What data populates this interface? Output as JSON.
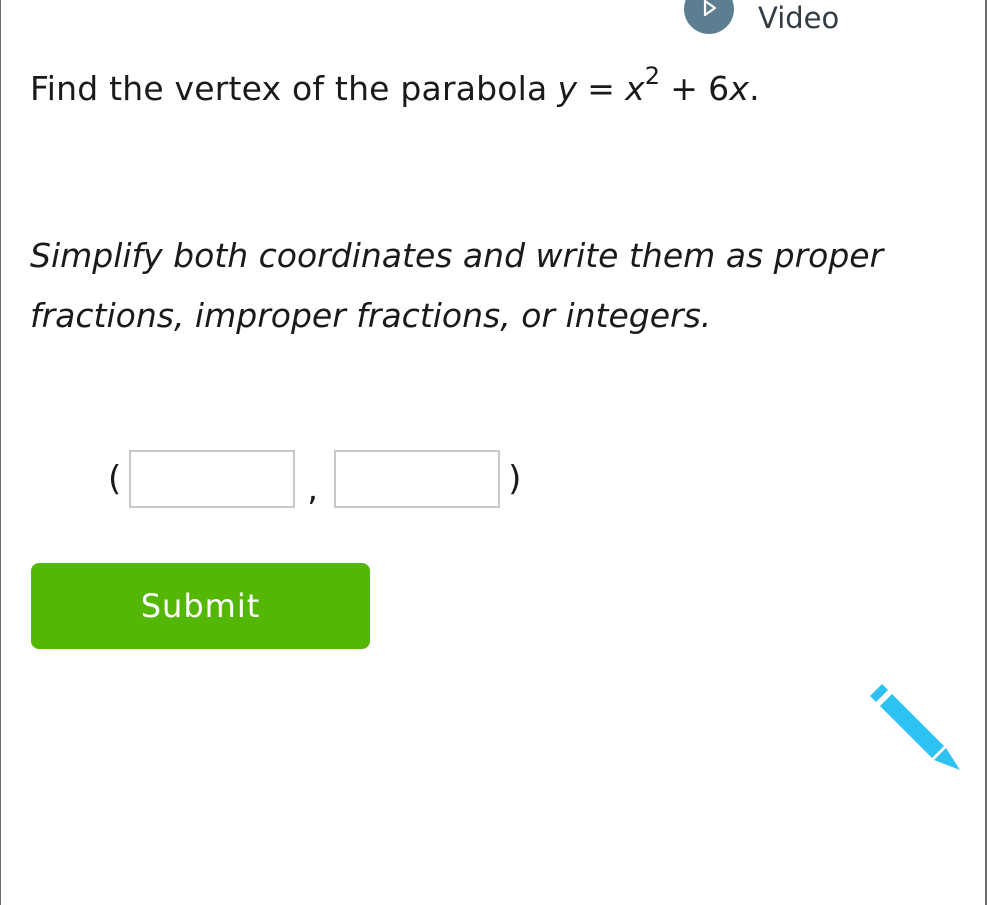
{
  "header": {
    "video_label": "Video",
    "video_icon": "play-circle-icon"
  },
  "question": {
    "prefix": "Find the vertex of the parabola",
    "equation": {
      "lhs": "y",
      "equals": "=",
      "term1_base": "x",
      "term1_exponent": "2",
      "plus": "+",
      "term2_coefficient": "6",
      "term2_variable": "x",
      "end": "."
    }
  },
  "instruction": "Simplify both coordinates and write them as proper fractions, improper fractions, or integers.",
  "answer": {
    "open_paren": "(",
    "separator": ",",
    "close_paren": ")",
    "x_value": "",
    "y_value": ""
  },
  "submit": {
    "label": "Submit"
  },
  "tools": {
    "pencil_icon": "pencil-icon"
  },
  "colors": {
    "submit_bg": "#55b705",
    "video_icon_bg": "#5b7f90",
    "pencil": "#2ec2f2",
    "border": "#6f6f6f"
  }
}
